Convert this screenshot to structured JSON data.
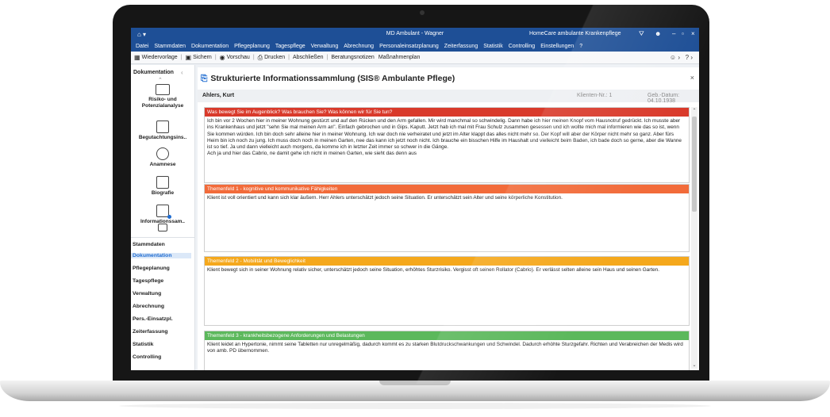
{
  "window": {
    "title": "MD Ambulant - Wagner",
    "product": "HomeCare ambulante Krankenpflege",
    "menu": [
      "Datei",
      "Stammdaten",
      "Dokumentation",
      "Pflegeplanung",
      "Tagespflege",
      "Verwaltung",
      "Abrechnung",
      "Personaleinsatzplanung",
      "Zeiterfassung",
      "Statistik",
      "Controlling",
      "Einstellungen",
      "?"
    ]
  },
  "toolbar": {
    "items": [
      "Wiedervorlage",
      "Sichern",
      "Vorschau",
      "Drucken",
      "Abschließen",
      "Beratungsnotizen",
      "Maßnahmenplan"
    ]
  },
  "sidebar": {
    "header": "Dokumentation",
    "items": [
      "Risiko- und Potenzialanalyse",
      "Begutachtungsins..",
      "Anamnese",
      "Biografie",
      "Informationssam.."
    ],
    "nav": [
      "Stammdaten",
      "Dokumentation",
      "Pflegeplanung",
      "Tagespflege",
      "Verwaltung",
      "Abrechnung",
      "Pers.-Einsatzpl.",
      "Zeiterfassung",
      "Statistik",
      "Controlling"
    ],
    "active_nav": "Dokumentation"
  },
  "panel": {
    "title": "Strukturierte Informationssammlung (SIS® Ambulante Pflege)",
    "patient": "Ahlers, Kurt",
    "klienten_nr_label": "Klienten-Nr.:",
    "klienten_nr": "1",
    "geb_label": "Geb.-Datum:",
    "geb_datum": "04.10.1938"
  },
  "sections": [
    {
      "header": "Was bewegt Sie im Augenblick? Was brauchen Sie? Was können wir für Sie tun?",
      "color": "#d93a2b",
      "text": "Ich bin vor 2 Wochen hier in meiner Wohnung gestürzt und auf den Rücken und den Arm gefallen. Mir wird manchmal so schwindelig. Dann habe ich hier meinen Knopf vom Hausnotruf gedrückt. Ich musste aber ins Krankenhaus und jetzt \"sehn Sie mal meinen Arm an\". Einfach gebrochen und in Gips. Kaputt. Jetzt hab ich mal mit Frau Schulz zusammen gesessen und ich wollte mich mal informieren wie das so ist, wenn Sie kommen würden. Ich bin doch sehr alleine hier in meiner Wohnung. Ich war doch nie verheiratet und jetzt im Alter klappt das alles nicht mehr so. Der Kopf will aber der Körper nicht mehr so ganz. Aber fürs Heim bin ich noch zu jung. Ich muss doch noch in meinen Garten, nee das kann ich jetzt noch nicht. Ich brauche ein bisschen Hilfe im Haushalt und vielleicht beim Baden, ich bade doch so gerne, aber die Wanne ist so tief. Ja und dann vielleicht auch morgens, da komme ich in letzter Zeit immer so schwer in die Gänge.",
      "text2": "Ach ja und hier das Cabrio, ne damit gehe ich nicht in meinen Garten, wie sieht das denn aus"
    },
    {
      "header": "Themenfeld 1 - kognitive und kommunikative Fähigkeiten",
      "color": "#f26b3a",
      "text": "Klient ist voll orientiert und kann sich klar äußern. Herr Ahlers unterschätzt jedoch seine Situation. Er unterschätzt sein Alter und seine körperliche Konstitution."
    },
    {
      "header": "Themenfeld 2 - Mobilität und Beweglichkeit",
      "color": "#f5a81c",
      "text": "Klient bewegt sich in seiner Wohnung relativ sicher, unterschätzt jedoch seine Situation, erhöhtes Sturzrisiko. Vergisst oft seinen Rollator (Cabrio). Er verlässt selten alleine sein Haus und seinen Garten."
    },
    {
      "header": "Themenfeld 3 - krankheitsbezogene Anforderungen und Belastungen",
      "color": "#5cb85c",
      "text": "Klient leidet an Hypertonie, nimmt seine Tabletten nur unregelmäßig, dadurch kommt es zu starken Blutdruckschwankungen und Schwindel. Dadurch erhöhte Sturzgefahr. Richten und Verabreichen der Medis wird von amb. PD übernommen."
    }
  ]
}
